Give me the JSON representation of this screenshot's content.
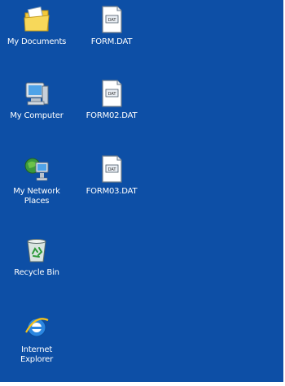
{
  "desktop": {
    "icons": [
      {
        "label": "My Documents",
        "icon": "folder-documents-icon"
      },
      {
        "label": "FORM.DAT",
        "icon": "dat-file-icon"
      },
      {
        "label": "My Computer",
        "icon": "computer-icon"
      },
      {
        "label": "FORM02.DAT",
        "icon": "dat-file-icon"
      },
      {
        "label": "My Network Places",
        "icon": "network-places-icon"
      },
      {
        "label": "FORM03.DAT",
        "icon": "dat-file-icon"
      },
      {
        "label": "Recycle Bin",
        "icon": "recycle-bin-icon"
      },
      {
        "label": "Internet Explorer",
        "icon": "internet-explorer-icon"
      }
    ],
    "file_badge_text": "DAT",
    "colors": {
      "background": "#0d4fa6",
      "label_text": "#ffffff"
    }
  }
}
